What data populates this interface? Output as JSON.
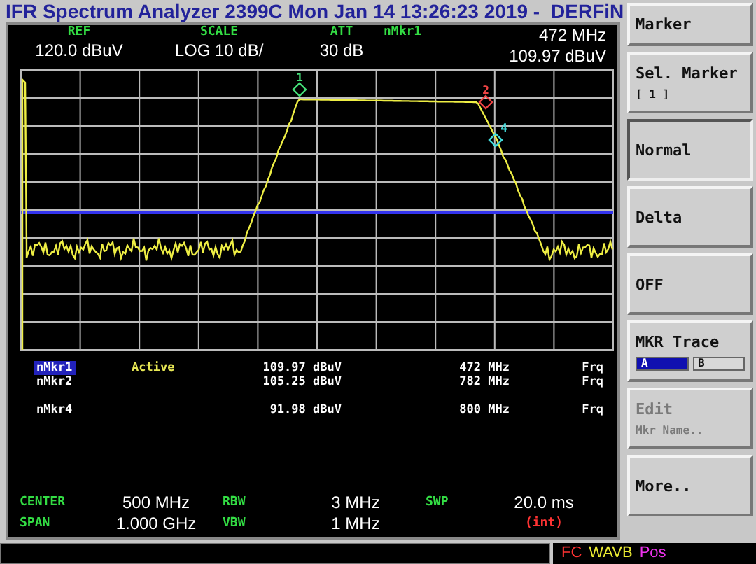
{
  "title": {
    "text": "IFR Spectrum Analyzer 2399C Mon Jan 14 13:26:23 2019 -",
    "user": "DERFiN"
  },
  "header": [
    {
      "label": "REF",
      "value": "120.0 dBuV"
    },
    {
      "label": "SCALE",
      "value": "LOG 10 dB/"
    },
    {
      "label": "ATT",
      "value": "30 dB"
    },
    {
      "label": "nMkr1",
      "value": "109.97 dBuV",
      "reading": "472 MHz"
    }
  ],
  "graph": {
    "markers": [
      {
        "label": "1",
        "color": "#44dd77"
      },
      {
        "label": "2",
        "color": "#ee4444"
      },
      {
        "label": "4",
        "color": "#44dddd"
      }
    ]
  },
  "marker_table": [
    {
      "kind": "marker",
      "name": "nMkr1",
      "selected": true,
      "status": "Active",
      "amplitude": "109.97 dBuV",
      "frequency": "472 MHz",
      "mode": "Frq"
    },
    {
      "kind": "marker",
      "name": "nMkr2",
      "selected": false,
      "amplitude": "105.25 dBuV",
      "frequency": "782 MHz",
      "mode": "Frq"
    },
    {
      "kind": "blank"
    },
    {
      "kind": "marker",
      "name": "nMkr4",
      "selected": false,
      "amplitude": "91.98 dBuV",
      "frequency": "800 MHz",
      "mode": "Frq"
    }
  ],
  "footer": [
    {
      "label": "CENTER",
      "value": "500 MHz"
    },
    {
      "label": "RBW",
      "value": "3 MHz"
    },
    {
      "label": "SWP",
      "value": "20.0 ms"
    },
    {
      "label": "SPAN",
      "value": "1.000 GHz"
    },
    {
      "label": "VBW",
      "value": "1 MHz"
    },
    {
      "kind": "note",
      "value": "(int)"
    }
  ],
  "softkeys": [
    {
      "kind": "heading",
      "label": "Marker"
    },
    {
      "kind": "key",
      "label": "Sel. Marker",
      "sublabel": "[ 1 ]",
      "disabled": false
    },
    {
      "kind": "option",
      "label": "Normal",
      "selected": true
    },
    {
      "kind": "option",
      "label": "Delta",
      "selected": false
    },
    {
      "kind": "option",
      "label": "OFF",
      "selected": false
    },
    {
      "kind": "toggle",
      "label": "MKR Trace",
      "options": [
        {
          "label": "A",
          "selected": true
        },
        {
          "label": "B",
          "selected": false
        }
      ]
    },
    {
      "kind": "key",
      "label": "Edit",
      "sublabel": "Mkr Name..",
      "disabled": true
    },
    {
      "kind": "key",
      "label": "More..",
      "disabled": false
    }
  ],
  "status_bar": [
    {
      "text": "FC",
      "color": "#ff3333"
    },
    {
      "text": "WAVB",
      "color": "#eeee33"
    },
    {
      "text": "Pos",
      "color": "#ee33ee"
    }
  ]
}
